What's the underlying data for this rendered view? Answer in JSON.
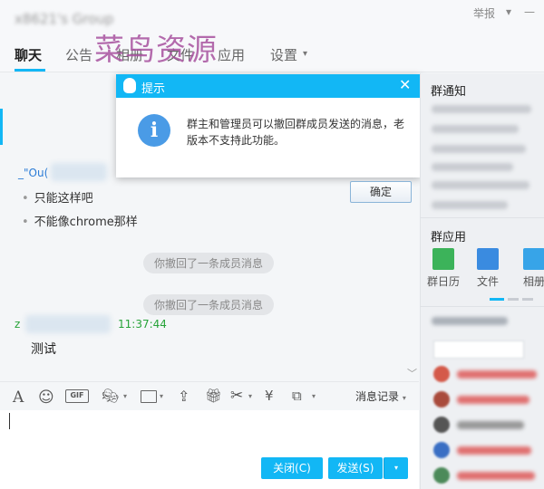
{
  "header": {
    "group_name": "x8621's Group",
    "report": "举报",
    "watermark": "菜鸟资源",
    "tabs": [
      {
        "label": "聊天",
        "active": true
      },
      {
        "label": "公告",
        "active": false
      },
      {
        "label": "相册",
        "active": false
      },
      {
        "label": "文件",
        "active": false
      },
      {
        "label": "应用",
        "active": false
      },
      {
        "label": "设置",
        "active": false
      }
    ],
    "settings_caret": "▾"
  },
  "chat": {
    "sender_prefix": "_\"Ou(",
    "lines": [
      "只能这样吧",
      "不能像chrome那样"
    ],
    "system_notices": [
      "你撤回了一条成员消息",
      "你撤回了一条成员消息"
    ],
    "msg2_sender": "z",
    "msg2_time": "11:37:44",
    "msg2_text": "测试"
  },
  "dialog": {
    "title": "提示",
    "message": "群主和管理员可以撤回群成员发送的消息，老版本不支持此功能。",
    "ok": "确定"
  },
  "right_panel": {
    "notice_title": "群通知",
    "apps_title": "群应用",
    "apps": [
      {
        "label": "群日历",
        "icon": "calendar-icon",
        "color": "#3cb35a"
      },
      {
        "label": "文件",
        "icon": "folder-icon",
        "color": "#3a8be0"
      },
      {
        "label": "相册",
        "icon": "photo-icon",
        "color": "#37a4e8"
      }
    ]
  },
  "toolbar": {
    "history": "消息记录",
    "gif": "GIF"
  },
  "buttons": {
    "close": "关闭(C)",
    "send": "发送(S)"
  },
  "colors": {
    "accent": "#12b7f5",
    "time_green": "#27a339",
    "watermark": "#a8529f"
  }
}
